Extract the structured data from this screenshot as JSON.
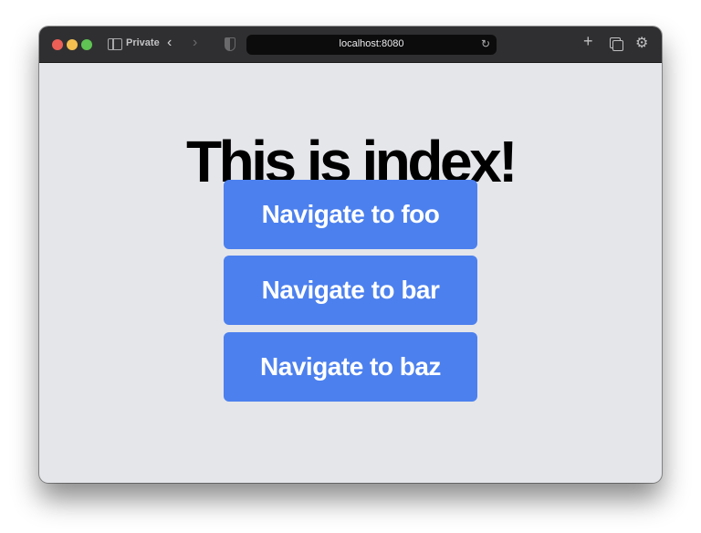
{
  "browser": {
    "mode_label": "Private",
    "url": "localhost:8080",
    "icons": {
      "sidebar": "sidebar-icon",
      "back": "chevron-left-icon",
      "forward": "chevron-right-icon",
      "privacy": "shield-icon",
      "reload": "reload-icon",
      "new_tab": "plus-icon",
      "tab_overview": "tabs-icon",
      "settings": "gear-icon"
    }
  },
  "page": {
    "title": "This is index!",
    "buttons": [
      {
        "label": "Navigate to foo"
      },
      {
        "label": "Navigate to bar"
      },
      {
        "label": "Navigate to baz"
      }
    ]
  },
  "colors": {
    "button_bg": "#4c80ee",
    "page_bg": "#e5e6ea",
    "titlebar_bg": "#2f2f31"
  }
}
